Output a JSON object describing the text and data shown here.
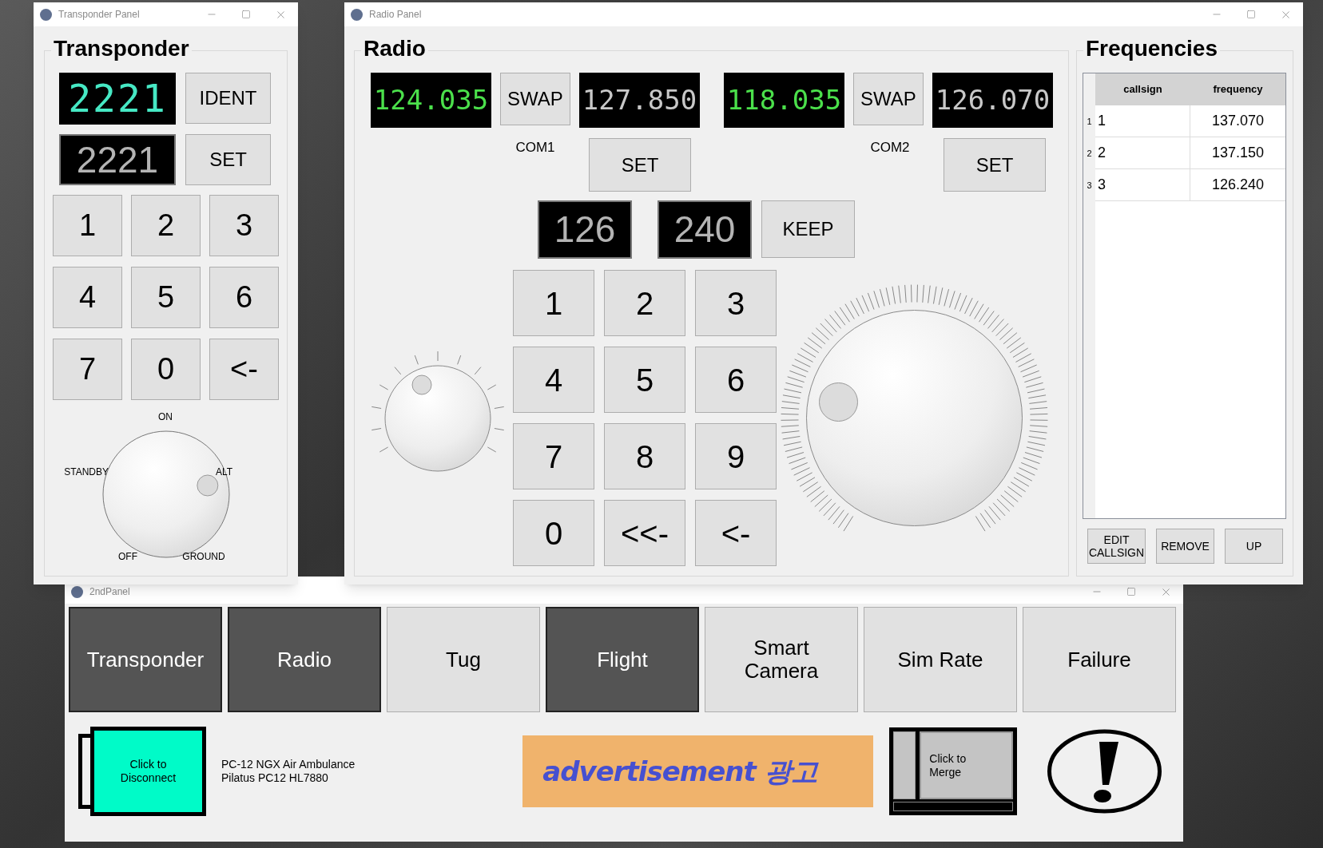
{
  "second_panel": {
    "title": "2ndPanel",
    "nav_buttons": [
      {
        "label": "Transponder",
        "selected": true
      },
      {
        "label": "Radio",
        "selected": true
      },
      {
        "label": "Tug",
        "selected": false
      },
      {
        "label": "Flight",
        "selected": true
      },
      {
        "label": "Smart Camera",
        "selected": false
      },
      {
        "label": "Sim Rate",
        "selected": false
      },
      {
        "label": "Failure",
        "selected": false
      }
    ],
    "connect_button": "Click to Disconnect",
    "aircraft": [
      "PC-12 NGX Air Ambulance",
      "Pilatus PC12 HL7880"
    ],
    "advertisement": "advertisement 광고",
    "merge_button": "Click to Merge"
  },
  "transponder": {
    "title": "Transponder Panel",
    "heading": "Transponder",
    "code_display": "2221",
    "ident_button": "IDENT",
    "entry_display": "2221",
    "set_button": "SET",
    "keypad": [
      "1",
      "2",
      "3",
      "4",
      "5",
      "6",
      "7",
      "0",
      "<-"
    ],
    "mode_knob": [
      {
        "label": "ON",
        "selected": false
      },
      {
        "label": "STANDBY",
        "selected": false
      },
      {
        "label": "ALT",
        "selected": true
      },
      {
        "label": "OFF",
        "selected": false
      },
      {
        "label": "GROUND",
        "selected": false
      }
    ]
  },
  "radio": {
    "title": "Radio Panel",
    "heading": "Radio",
    "com": [
      {
        "active": "124.035",
        "swap": "SWAP",
        "standby": "127.850",
        "label": "COM1",
        "set": "SET"
      },
      {
        "active": "118.035",
        "swap": "SWAP",
        "standby": "126.070",
        "label": "COM2",
        "set": "SET"
      }
    ],
    "entry": [
      "126",
      "240"
    ],
    "keep_button": "KEEP",
    "keypad": [
      "1",
      "2",
      "3",
      "4",
      "5",
      "6",
      "7",
      "8",
      "9",
      "0",
      "<<-",
      "<-"
    ]
  },
  "frequencies": {
    "heading": "Frequencies",
    "columns": [
      "callsign",
      "frequency"
    ],
    "rows": [
      {
        "index": "1",
        "callsign": "1",
        "frequency": "137.070"
      },
      {
        "index": "2",
        "callsign": "2",
        "frequency": "137.150"
      },
      {
        "index": "3",
        "callsign": "3",
        "frequency": "126.240"
      }
    ],
    "buttons": [
      "EDIT CALLSIGN",
      "REMOVE",
      "UP"
    ]
  }
}
